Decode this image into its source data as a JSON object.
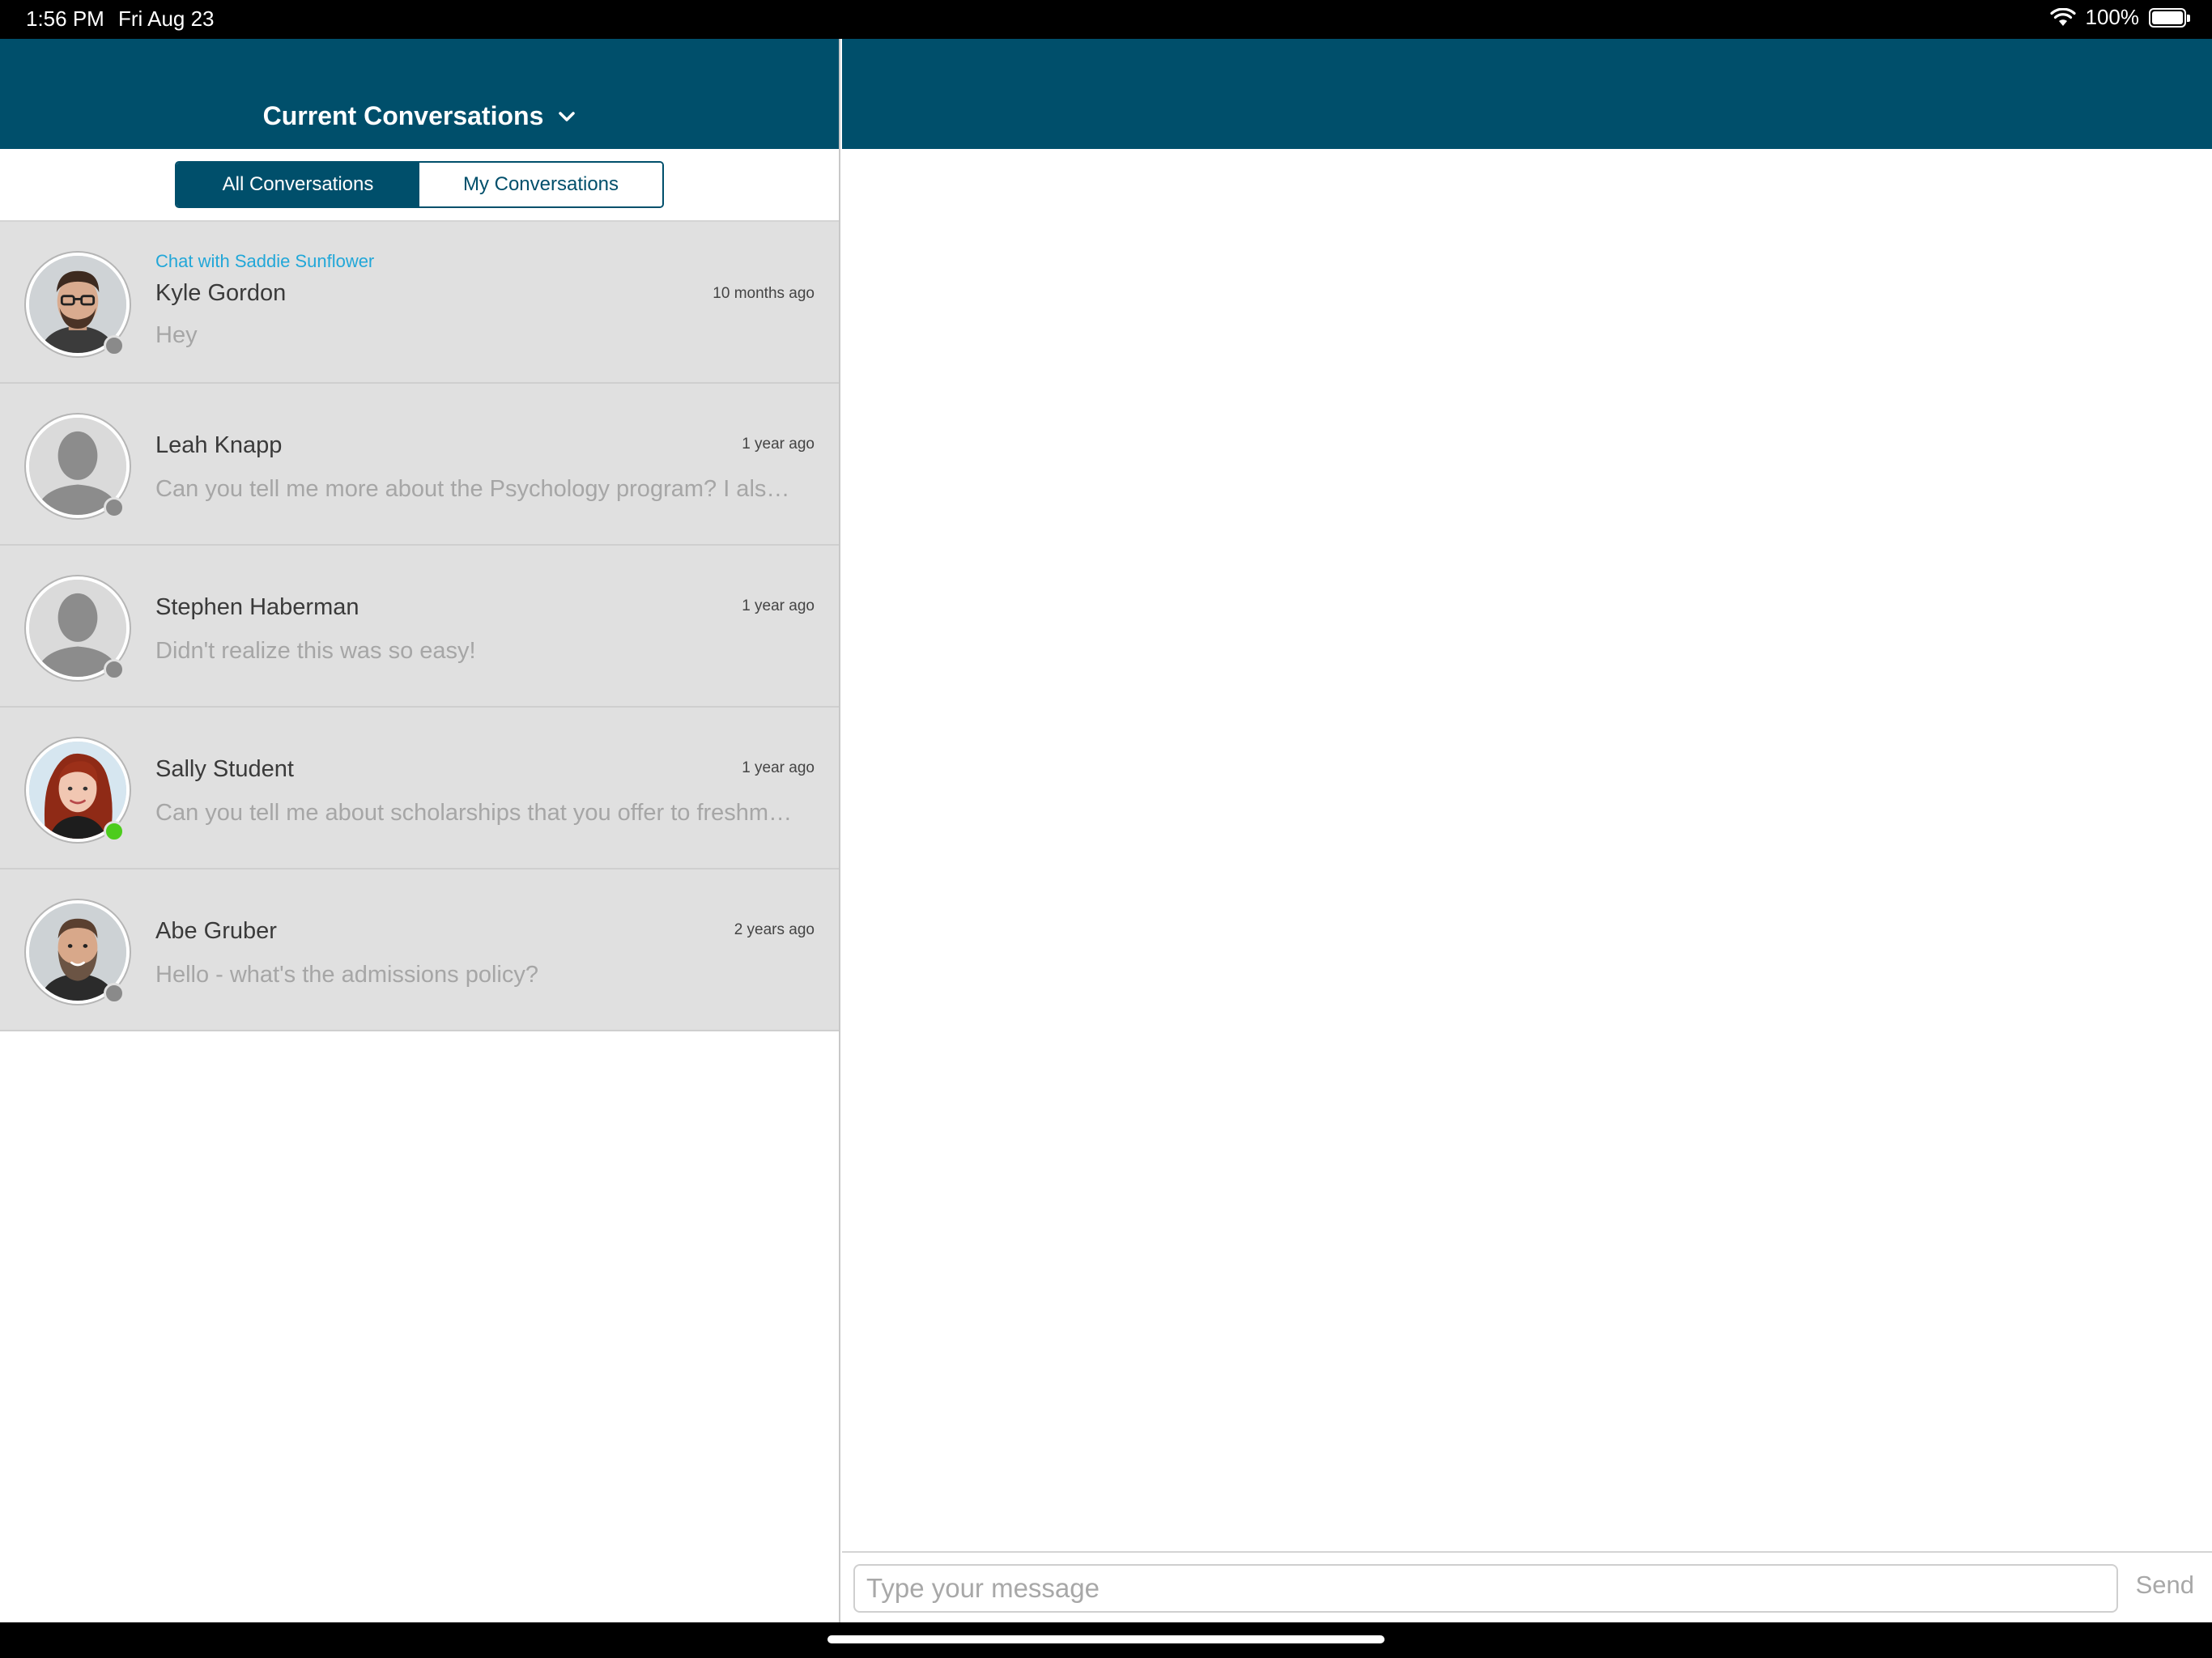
{
  "status": {
    "time": "1:56 PM",
    "date": "Fri Aug 23",
    "battery": "100%"
  },
  "header": {
    "title": "Current Conversations"
  },
  "tabs": {
    "all": "All Conversations",
    "mine": "My Conversations"
  },
  "conversations": [
    {
      "chat_with": "Chat with Saddie Sunflower",
      "name": "Kyle Gordon",
      "time": "10 months ago",
      "preview": "Hey",
      "online": false,
      "avatar": "photo-man-glasses"
    },
    {
      "chat_with": "",
      "name": "Leah Knapp",
      "time": "1 year ago",
      "preview": "Can you tell me more about the Psychology program? I also…",
      "online": false,
      "avatar": "default"
    },
    {
      "chat_with": "",
      "name": "Stephen Haberman",
      "time": "1 year ago",
      "preview": "Didn't realize this was so easy!",
      "online": false,
      "avatar": "default"
    },
    {
      "chat_with": "",
      "name": "Sally Student",
      "time": "1 year ago",
      "preview": "Can you tell me about scholarships that you offer to freshman?",
      "online": true,
      "avatar": "photo-woman-redhair"
    },
    {
      "chat_with": "",
      "name": "Abe Gruber",
      "time": "2 years ago",
      "preview": "Hello - what's the admissions policy?",
      "online": false,
      "avatar": "photo-man-beard"
    }
  ],
  "composer": {
    "placeholder": "Type your message",
    "send": "Send"
  },
  "colors": {
    "brand": "#004f6b",
    "link": "#22a7d8",
    "online": "#4ccc1c"
  }
}
